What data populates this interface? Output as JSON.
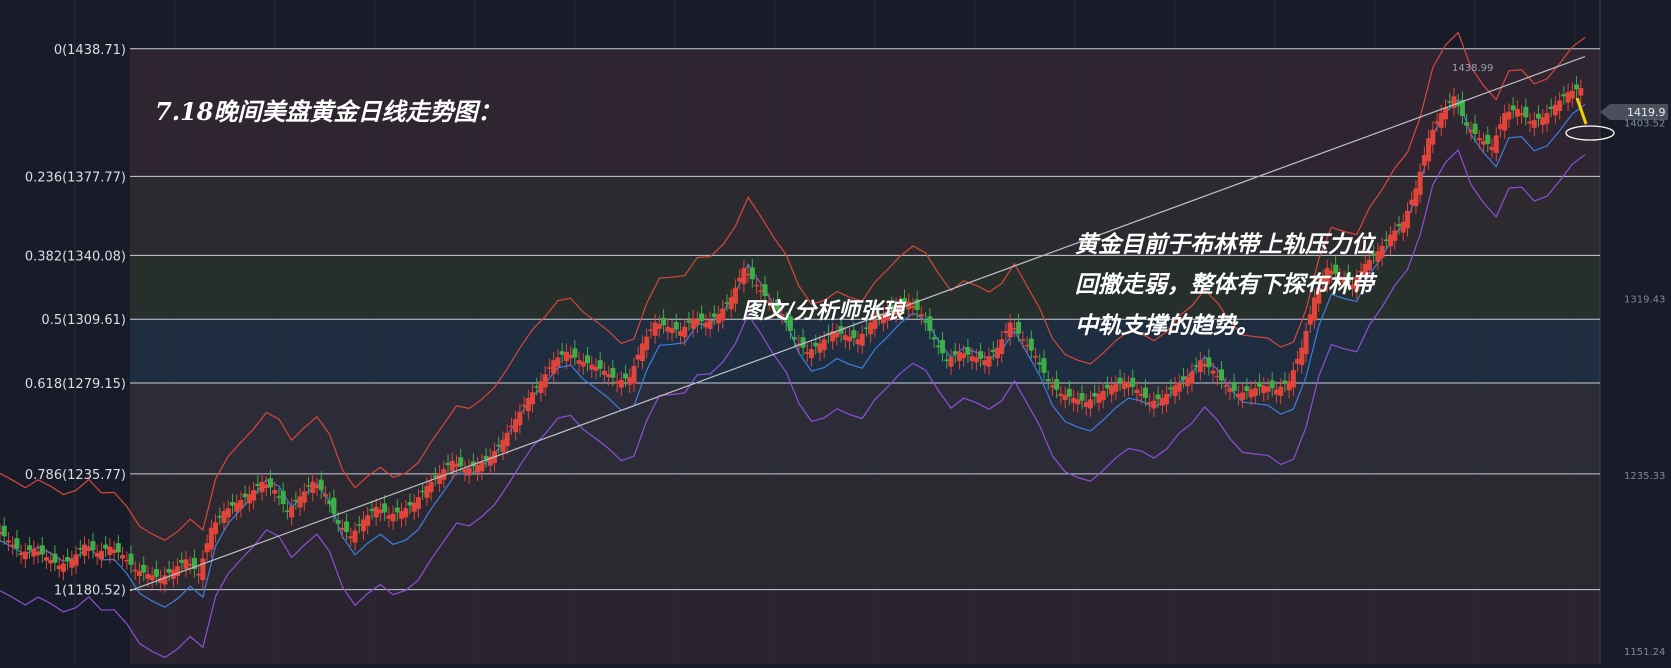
{
  "chart_data": {
    "type": "candlestick",
    "title": "7.18晚间美盘黄金日线走势图：",
    "annotation_lines": [
      "黄金目前于布林带上轨压力位",
      "回撤走弱，整体有下探布林带",
      "中轨支撑的趋势。"
    ],
    "author": "图文/分析师张琅",
    "y_range": [
      1145,
      1462
    ],
    "fib_levels": [
      {
        "label": "0(1438.71)",
        "ratio": 0,
        "price": 1438.71
      },
      {
        "label": "0.236(1377.77)",
        "ratio": 0.236,
        "price": 1377.77
      },
      {
        "label": "0.382(1340.08)",
        "ratio": 0.382,
        "price": 1340.08
      },
      {
        "label": "0.5(1309.61)",
        "ratio": 0.5,
        "price": 1309.61
      },
      {
        "label": "0.618(1279.15)",
        "ratio": 0.618,
        "price": 1279.15
      },
      {
        "label": "0.786(1235.77)",
        "ratio": 0.786,
        "price": 1235.77
      },
      {
        "label": "1(1180.52)",
        "ratio": 1,
        "price": 1180.52
      }
    ],
    "y_axis_ticks": [
      "1403.52",
      "1319.43",
      "1235.33",
      "1151.24"
    ],
    "current_price": "1419.9",
    "peak_label": "1438.99",
    "candles_close_path": [
      [
        0,
        1210
      ],
      [
        10,
        1204
      ],
      [
        20,
        1198
      ],
      [
        30,
        1200
      ],
      [
        40,
        1196
      ],
      [
        50,
        1192
      ],
      [
        60,
        1195
      ],
      [
        70,
        1202
      ],
      [
        80,
        1198
      ],
      [
        90,
        1201
      ],
      [
        100,
        1197
      ],
      [
        110,
        1190
      ],
      [
        120,
        1188
      ],
      [
        130,
        1186
      ],
      [
        140,
        1190
      ],
      [
        150,
        1195
      ],
      [
        160,
        1188
      ],
      [
        170,
        1210
      ],
      [
        180,
        1218
      ],
      [
        190,
        1222
      ],
      [
        200,
        1226
      ],
      [
        210,
        1232
      ],
      [
        220,
        1228
      ],
      [
        230,
        1218
      ],
      [
        240,
        1225
      ],
      [
        250,
        1232
      ],
      [
        260,
        1226
      ],
      [
        270,
        1212
      ],
      [
        280,
        1206
      ],
      [
        290,
        1214
      ],
      [
        300,
        1220
      ],
      [
        310,
        1216
      ],
      [
        320,
        1218
      ],
      [
        330,
        1222
      ],
      [
        340,
        1230
      ],
      [
        350,
        1236
      ],
      [
        360,
        1242
      ],
      [
        370,
        1238
      ],
      [
        380,
        1240
      ],
      [
        390,
        1244
      ],
      [
        400,
        1252
      ],
      [
        410,
        1262
      ],
      [
        420,
        1272
      ],
      [
        430,
        1280
      ],
      [
        440,
        1290
      ],
      [
        450,
        1294
      ],
      [
        460,
        1290
      ],
      [
        470,
        1288
      ],
      [
        480,
        1285
      ],
      [
        490,
        1280
      ],
      [
        500,
        1282
      ],
      [
        510,
        1298
      ],
      [
        520,
        1308
      ],
      [
        530,
        1306
      ],
      [
        540,
        1304
      ],
      [
        550,
        1310
      ],
      [
        560,
        1308
      ],
      [
        570,
        1312
      ],
      [
        580,
        1320
      ],
      [
        590,
        1334
      ],
      [
        600,
        1326
      ],
      [
        610,
        1318
      ],
      [
        620,
        1312
      ],
      [
        630,
        1300
      ],
      [
        640,
        1294
      ],
      [
        650,
        1298
      ],
      [
        660,
        1304
      ],
      [
        670,
        1302
      ],
      [
        680,
        1300
      ],
      [
        690,
        1308
      ],
      [
        700,
        1312
      ],
      [
        710,
        1316
      ],
      [
        720,
        1318
      ],
      [
        730,
        1312
      ],
      [
        740,
        1300
      ],
      [
        750,
        1290
      ],
      [
        760,
        1294
      ],
      [
        770,
        1292
      ],
      [
        780,
        1290
      ],
      [
        790,
        1296
      ],
      [
        800,
        1308
      ],
      [
        810,
        1300
      ],
      [
        820,
        1292
      ],
      [
        830,
        1280
      ],
      [
        840,
        1274
      ],
      [
        850,
        1272
      ],
      [
        860,
        1270
      ],
      [
        870,
        1274
      ],
      [
        880,
        1278
      ],
      [
        890,
        1280
      ],
      [
        900,
        1276
      ],
      [
        910,
        1270
      ],
      [
        920,
        1272
      ],
      [
        930,
        1278
      ],
      [
        940,
        1282
      ],
      [
        950,
        1290
      ],
      [
        960,
        1285
      ],
      [
        970,
        1278
      ],
      [
        980,
        1274
      ],
      [
        990,
        1276
      ],
      [
        1000,
        1278
      ],
      [
        1010,
        1276
      ],
      [
        1020,
        1280
      ],
      [
        1030,
        1296
      ],
      [
        1040,
        1320
      ],
      [
        1050,
        1334
      ],
      [
        1060,
        1330
      ],
      [
        1070,
        1326
      ],
      [
        1080,
        1336
      ],
      [
        1090,
        1342
      ],
      [
        1100,
        1350
      ],
      [
        1110,
        1356
      ],
      [
        1120,
        1372
      ],
      [
        1130,
        1396
      ],
      [
        1140,
        1408
      ],
      [
        1150,
        1416
      ],
      [
        1160,
        1402
      ],
      [
        1170,
        1396
      ],
      [
        1180,
        1392
      ],
      [
        1190,
        1408
      ],
      [
        1200,
        1410
      ],
      [
        1210,
        1404
      ],
      [
        1220,
        1406
      ],
      [
        1230,
        1412
      ],
      [
        1240,
        1418
      ],
      [
        1250,
        1420
      ]
    ]
  }
}
